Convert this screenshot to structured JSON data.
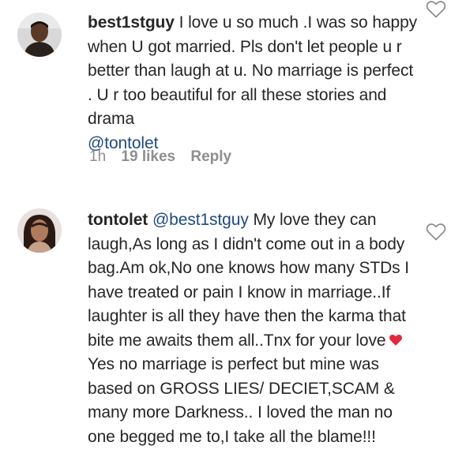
{
  "comments": [
    {
      "username": "best1stguy",
      "text": " I love u so much .I was so happy when U got married. Pls don't let people u r better than laugh at u. No marriage is perfect . U r too beautiful for all these stories and drama\n",
      "trailing_mention": "@tontolet",
      "time": "1h",
      "likes": "19 likes",
      "reply_label": "Reply",
      "like_icon": "heart-outline-icon"
    },
    {
      "username": "tontolet",
      "mention": "@best1stguy",
      "text_before_heart": " My love they can laugh,As long as I didn't come out in a body bag.Am ok,No one knows how many STDs I have treated or pain I know in marriage..If laughter is all they have then the karma that bite me awaits them all..Tnx for your love",
      "text_after_heart": "Yes no marriage is perfect but mine was based on GROSS LIES/ DECIET,SCAM & many more Darkness.. I loved the man no one begged me to,I take all the blame!!!",
      "emoji": "red-heart-emoji",
      "emoji_color": "#e02a3c",
      "like_icon": "heart-outline-icon"
    }
  ],
  "colors": {
    "text": "#262626",
    "mention": "#1f4a7e",
    "meta": "#8e8e8e"
  }
}
